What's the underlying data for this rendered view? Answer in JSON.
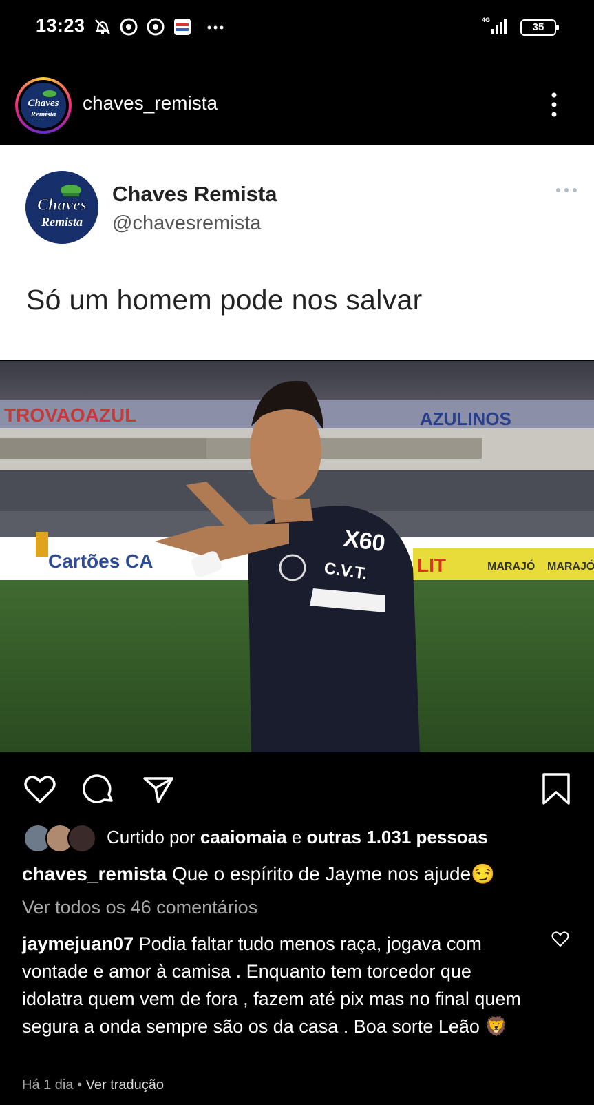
{
  "status_bar": {
    "time": "13:23",
    "network": "4G",
    "battery": "35",
    "icons": [
      "dnd-off-icon",
      "chrome-icon",
      "chrome-icon",
      "app-icon",
      "more-dots-icon",
      "signal-icon",
      "battery-icon"
    ]
  },
  "header": {
    "username": "chaves_remista",
    "avatar_text_1": "Chaves",
    "avatar_text_2": "Remista"
  },
  "tweet": {
    "display_name": "Chaves Remista",
    "handle": "@chavesremista",
    "text": "Só um homem pode nos salvar",
    "avatar_text_1": "Chaves",
    "avatar_text_2": "Remista"
  },
  "photo": {
    "banner_left": "TROVAOAZUL",
    "banner_right": "AZULINOS",
    "ad_left": "Cartões CA",
    "ad_right": "LIT",
    "ad_right2": "MARAJÓ",
    "shirt_number": "X60",
    "shirt_text": "C.V.T."
  },
  "actions": {
    "icons": [
      "heart-icon",
      "comment-icon",
      "share-icon",
      "bookmark-icon"
    ]
  },
  "likes": {
    "prefix": "Curtido por",
    "user": "caaiomaia",
    "connector": "e",
    "others": "outras 1.031 pessoas"
  },
  "caption": {
    "user": "chaves_remista",
    "text": "Que o espírito de Jayme nos ajude😏"
  },
  "view_all": "Ver todos os 46 comentários",
  "comment": {
    "user": "jaymejuan07",
    "text": "Podia faltar tudo menos raça, jogava com vontade e amor à camisa . Enquanto tem torcedor que idolatra quem vem de fora , fazem até pix mas no final quem segura a onda sempre são os da casa . Boa sorte Leão 🦁"
  },
  "meta": {
    "age": "Há 1 dia",
    "separator": "•",
    "translate": "Ver tradução"
  },
  "colors": {
    "background": "#000000",
    "card": "#ffffff",
    "muted": "#a8a8a8",
    "avatar_blue": "#17306b"
  }
}
